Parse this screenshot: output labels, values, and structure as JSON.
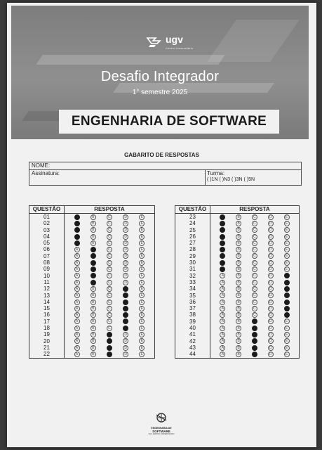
{
  "header": {
    "brand": "ugv",
    "brand_tagline": "Centro Universitário",
    "title": "Desafio Integrador",
    "subtitle": "1° semestre 2025",
    "course": "ENGENHARIA DE SOFTWARE"
  },
  "section_title": "GABARITO DE RESPOSTAS",
  "student_info": {
    "name_label": "NOME:",
    "signature_label": "Assinatura:",
    "class_label": "Turma:",
    "class_options": "(   )1N  (   )N3  (   )3N  (   )5N"
  },
  "table_headers": {
    "question": "QUESTÃO",
    "answer": "RESPOSTA"
  },
  "options": [
    "A",
    "B",
    "C",
    "D",
    "E"
  ],
  "left_sheet": [
    {
      "q": "01",
      "a": "A"
    },
    {
      "q": "02",
      "a": "A"
    },
    {
      "q": "03",
      "a": "A"
    },
    {
      "q": "04",
      "a": "A"
    },
    {
      "q": "05",
      "a": "A"
    },
    {
      "q": "06",
      "a": "B"
    },
    {
      "q": "07",
      "a": "B"
    },
    {
      "q": "08",
      "a": "B"
    },
    {
      "q": "09",
      "a": "B"
    },
    {
      "q": "10",
      "a": "B"
    },
    {
      "q": "11",
      "a": "B"
    },
    {
      "q": "12",
      "a": "D"
    },
    {
      "q": "13",
      "a": "D"
    },
    {
      "q": "14",
      "a": "D"
    },
    {
      "q": "15",
      "a": "D"
    },
    {
      "q": "16",
      "a": "D"
    },
    {
      "q": "17",
      "a": "D"
    },
    {
      "q": "18",
      "a": "D"
    },
    {
      "q": "19",
      "a": "C"
    },
    {
      "q": "20",
      "a": "C"
    },
    {
      "q": "21",
      "a": "C"
    },
    {
      "q": "22",
      "a": "C"
    }
  ],
  "right_sheet": [
    {
      "q": "23",
      "a": "A"
    },
    {
      "q": "24",
      "a": "A"
    },
    {
      "q": "25",
      "a": "A"
    },
    {
      "q": "26",
      "a": "A"
    },
    {
      "q": "27",
      "a": "A"
    },
    {
      "q": "28",
      "a": "A"
    },
    {
      "q": "29",
      "a": "A"
    },
    {
      "q": "30",
      "a": "A"
    },
    {
      "q": "31",
      "a": "A"
    },
    {
      "q": "32",
      "a": "E"
    },
    {
      "q": "33",
      "a": "E"
    },
    {
      "q": "34",
      "a": "E"
    },
    {
      "q": "35",
      "a": "E"
    },
    {
      "q": "36",
      "a": "E"
    },
    {
      "q": "37",
      "a": "E"
    },
    {
      "q": "38",
      "a": "E"
    },
    {
      "q": "39",
      "a": "C"
    },
    {
      "q": "40",
      "a": "C"
    },
    {
      "q": "41",
      "a": "C"
    },
    {
      "q": "42",
      "a": "C"
    },
    {
      "q": "43",
      "a": "C"
    },
    {
      "q": "44",
      "a": "C"
    }
  ],
  "footer": {
    "line1": "ENGENHARIA DE",
    "line2": "SOFTWARE",
    "line3": "UGV CENTRO UNIVERSITÁRIO"
  }
}
